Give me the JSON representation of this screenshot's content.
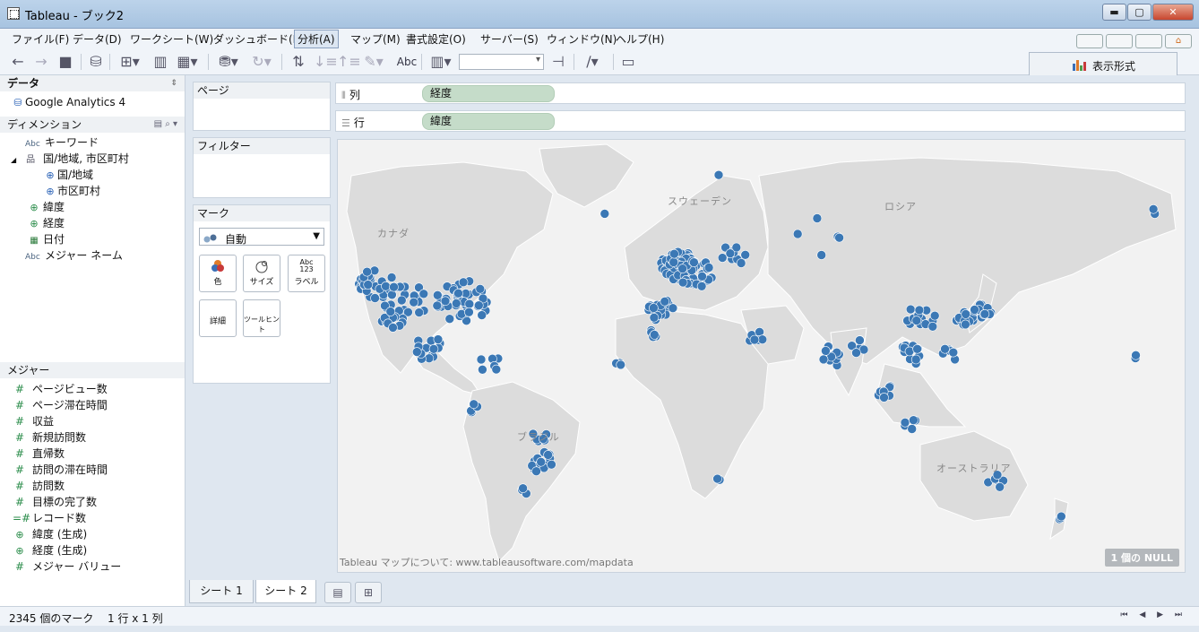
{
  "window": {
    "title": "Tableau - ブック2",
    "buttons": {
      "minimize": "▬",
      "maximize": "▢",
      "close": "✕"
    }
  },
  "menu": [
    {
      "label": "ファイル(F)"
    },
    {
      "label": "データ(D)"
    },
    {
      "label": "ワークシート(W)"
    },
    {
      "label": "ダッシュボード(B)"
    },
    {
      "label": "分析(A)",
      "active": true
    },
    {
      "label": "マップ(M)"
    },
    {
      "label": "書式設定(O)"
    },
    {
      "label": "サーバー(S)"
    },
    {
      "label": "ウィンドウ(N)"
    },
    {
      "label": "ヘルプ(H)"
    }
  ],
  "toolbar": {
    "abc_label": "Abc",
    "show_me_label": "表示形式",
    "bar_colors": [
      "#3b6fb6",
      "#e07b2a",
      "#4f9c4a",
      "#c83a3a"
    ]
  },
  "data_pane": {
    "header": "データ",
    "datasource": "Google Analytics 4",
    "dimensions_header": "ディメンション",
    "dimensions": [
      {
        "label": "キーワード",
        "icon": "abc-icon"
      },
      {
        "label": "国/地域, 市区町村",
        "icon": "hierarchy-icon"
      },
      {
        "label": "国/地域",
        "icon": "globe-icon"
      },
      {
        "label": "市区町村",
        "icon": "globe-icon"
      },
      {
        "label": "緯度",
        "icon": "globe-icon"
      },
      {
        "label": "経度",
        "icon": "globe-icon"
      },
      {
        "label": "日付",
        "icon": "calendar-icon"
      },
      {
        "label": "メジャー ネーム",
        "icon": "abc-icon"
      }
    ],
    "measures_header": "メジャー",
    "measures": [
      {
        "label": "ページビュー数",
        "icon": "hash-icon"
      },
      {
        "label": "ページ滞在時間",
        "icon": "hash-icon"
      },
      {
        "label": "収益",
        "icon": "hash-icon"
      },
      {
        "label": "新規訪問数",
        "icon": "hash-icon"
      },
      {
        "label": "直帰数",
        "icon": "hash-icon"
      },
      {
        "label": "訪問の滞在時間",
        "icon": "hash-icon"
      },
      {
        "label": "訪問数",
        "icon": "hash-icon"
      },
      {
        "label": "目標の完了数",
        "icon": "hash-icon"
      },
      {
        "label": "レコード数",
        "icon": "hash-icon"
      },
      {
        "label": "緯度 (生成)",
        "icon": "globe-icon"
      },
      {
        "label": "経度 (生成)",
        "icon": "globe-icon"
      },
      {
        "label": "メジャー バリュー",
        "icon": "hash-icon"
      }
    ]
  },
  "cards": {
    "pages": "ページ",
    "filters": "フィルター",
    "marks": "マーク",
    "mark_type": "自動",
    "mark_buttons": {
      "color": "色",
      "size": "サイズ",
      "label": "ラベル",
      "label_glyph": "Abc\n123",
      "detail": "詳細",
      "tooltip": "ツールヒント"
    }
  },
  "shelves": {
    "columns_label": "列",
    "columns_pill": "経度",
    "rows_label": "行",
    "rows_pill": "緯度"
  },
  "map": {
    "region_labels": [
      "カナダ",
      "スウェーデン",
      "ロシア",
      "ブラジル",
      "オーストラリア"
    ],
    "attribution": "Tableau マップについて: www.tableausoftware.com/mapdata",
    "null_badge": "1 個の NULL",
    "mark_color": "#3b78b5",
    "land_color": "#dcdcdc",
    "ocean_color": "#f2f2f2"
  },
  "tabs": [
    {
      "label": "シート 1",
      "active": false
    },
    {
      "label": "シート 2",
      "active": true
    }
  ],
  "status": {
    "marks": "2345 個のマーク",
    "dims": "1 行 x 1 列",
    "nav": "⏮ ◀ ▶ ⏭"
  }
}
